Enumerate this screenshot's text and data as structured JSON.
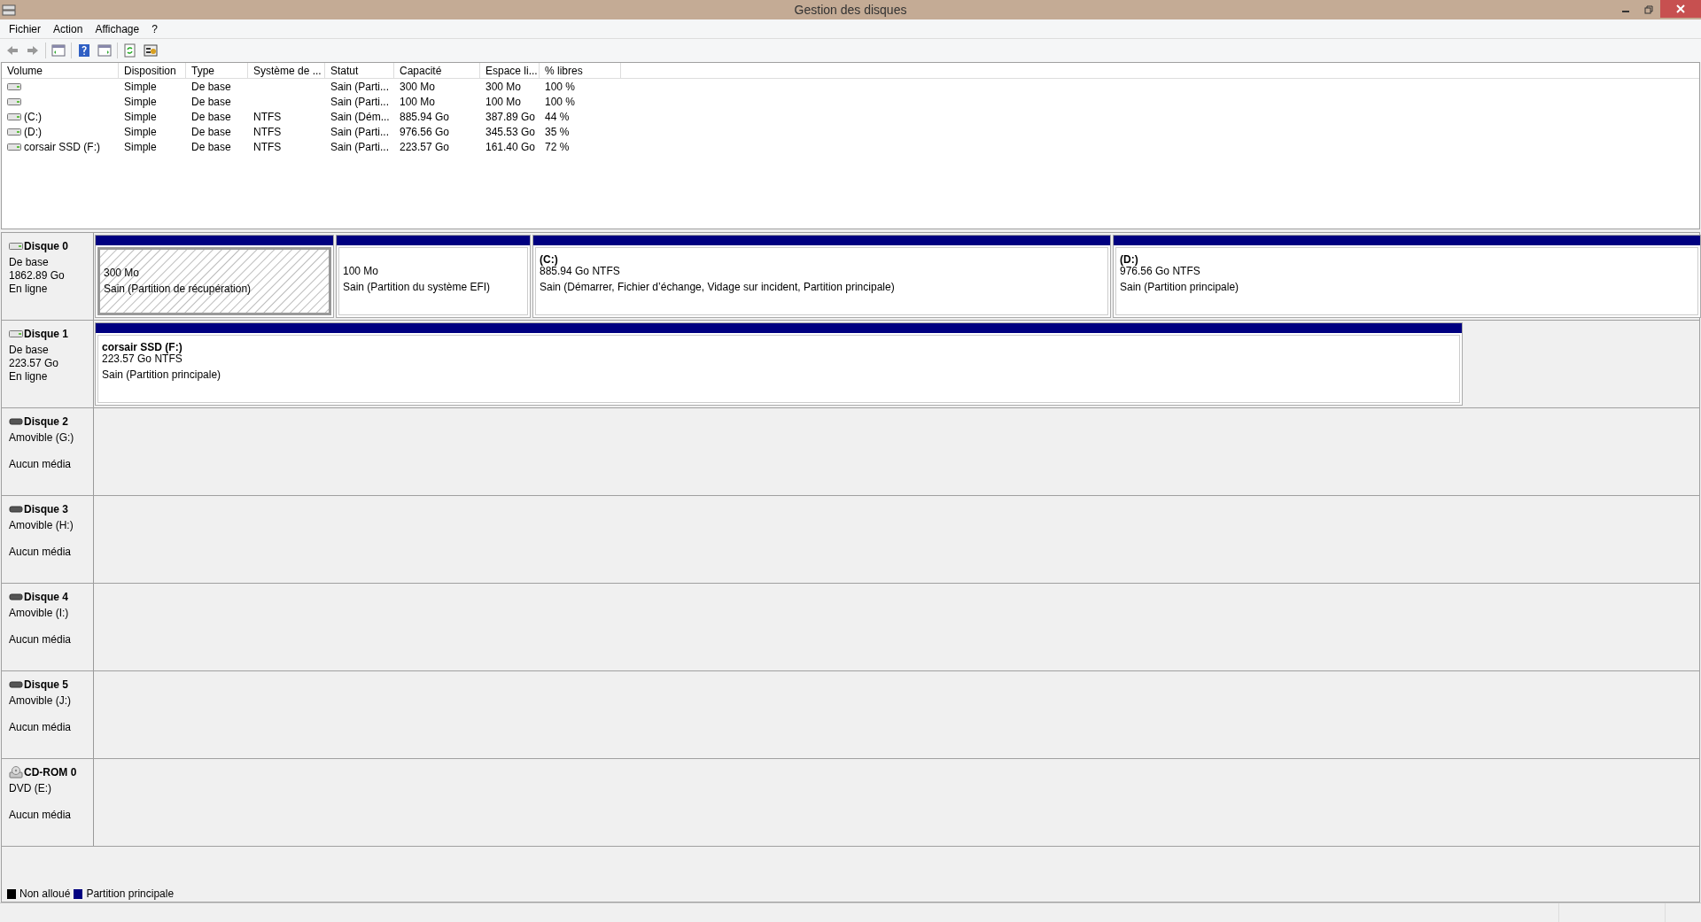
{
  "window": {
    "title": "Gestion des disques"
  },
  "menu": [
    "Fichier",
    "Action",
    "Affichage",
    "?"
  ],
  "table": {
    "columns": [
      "Volume",
      "Disposition",
      "Type",
      "Système de ...",
      "Statut",
      "Capacité",
      "Espace li...",
      "% libres"
    ],
    "rows": [
      [
        "",
        "Simple",
        "De base",
        "",
        "Sain (Parti...",
        "300 Mo",
        "300 Mo",
        "100 %"
      ],
      [
        "",
        "Simple",
        "De base",
        "",
        "Sain (Parti...",
        "100 Mo",
        "100 Mo",
        "100 %"
      ],
      [
        "(C:)",
        "Simple",
        "De base",
        "NTFS",
        "Sain (Dém...",
        "885.94 Go",
        "387.89 Go",
        "44 %"
      ],
      [
        "(D:)",
        "Simple",
        "De base",
        "NTFS",
        "Sain (Parti...",
        "976.56 Go",
        "345.53 Go",
        "35 %"
      ],
      [
        "corsair SSD (F:)",
        "Simple",
        "De base",
        "NTFS",
        "Sain (Parti...",
        "223.57 Go",
        "161.40 Go",
        "72 %"
      ]
    ]
  },
  "disks": [
    {
      "kind": "hdd",
      "name": "Disque 0",
      "lines": [
        "De base",
        "1862.89 Go",
        "En ligne"
      ],
      "partitions": [
        {
          "size": "300 Mo",
          "status": "Sain (Partition de récupération)",
          "selected": true
        },
        {
          "size": "100 Mo",
          "status": "Sain (Partition du système EFI)",
          "selected": false
        },
        {
          "name": "(C:)",
          "size": "885.94 Go NTFS",
          "status": "Sain (Démarrer, Fichier d’échange, Vidage sur incident, Partition principale)",
          "selected": false
        },
        {
          "name": "(D:)",
          "size": "976.56 Go NTFS",
          "status": "Sain (Partition principale)",
          "selected": false
        }
      ]
    },
    {
      "kind": "hdd",
      "name": "Disque 1",
      "lines": [
        "De base",
        "223.57 Go",
        "En ligne"
      ],
      "partitions": [
        {
          "name": "corsair SSD  (F:)",
          "size": "223.57 Go NTFS",
          "status": "Sain (Partition principale)",
          "selected": false
        }
      ]
    },
    {
      "kind": "removable",
      "name": "Disque 2",
      "lines": [
        "Amovible (G:)",
        "Aucun média"
      ]
    },
    {
      "kind": "removable",
      "name": "Disque 3",
      "lines": [
        "Amovible (H:)",
        "Aucun média"
      ]
    },
    {
      "kind": "removable",
      "name": "Disque 4",
      "lines": [
        "Amovible (I:)",
        "Aucun média"
      ]
    },
    {
      "kind": "removable",
      "name": "Disque 5",
      "lines": [
        "Amovible (J:)",
        "Aucun média"
      ]
    },
    {
      "kind": "cdrom",
      "name": "CD-ROM 0",
      "lines": [
        "DVD (E:)",
        "Aucun média"
      ]
    }
  ],
  "legend": [
    {
      "label": "Non alloué",
      "color": "#000000"
    },
    {
      "label": "Partition principale",
      "color": "#000080"
    }
  ]
}
